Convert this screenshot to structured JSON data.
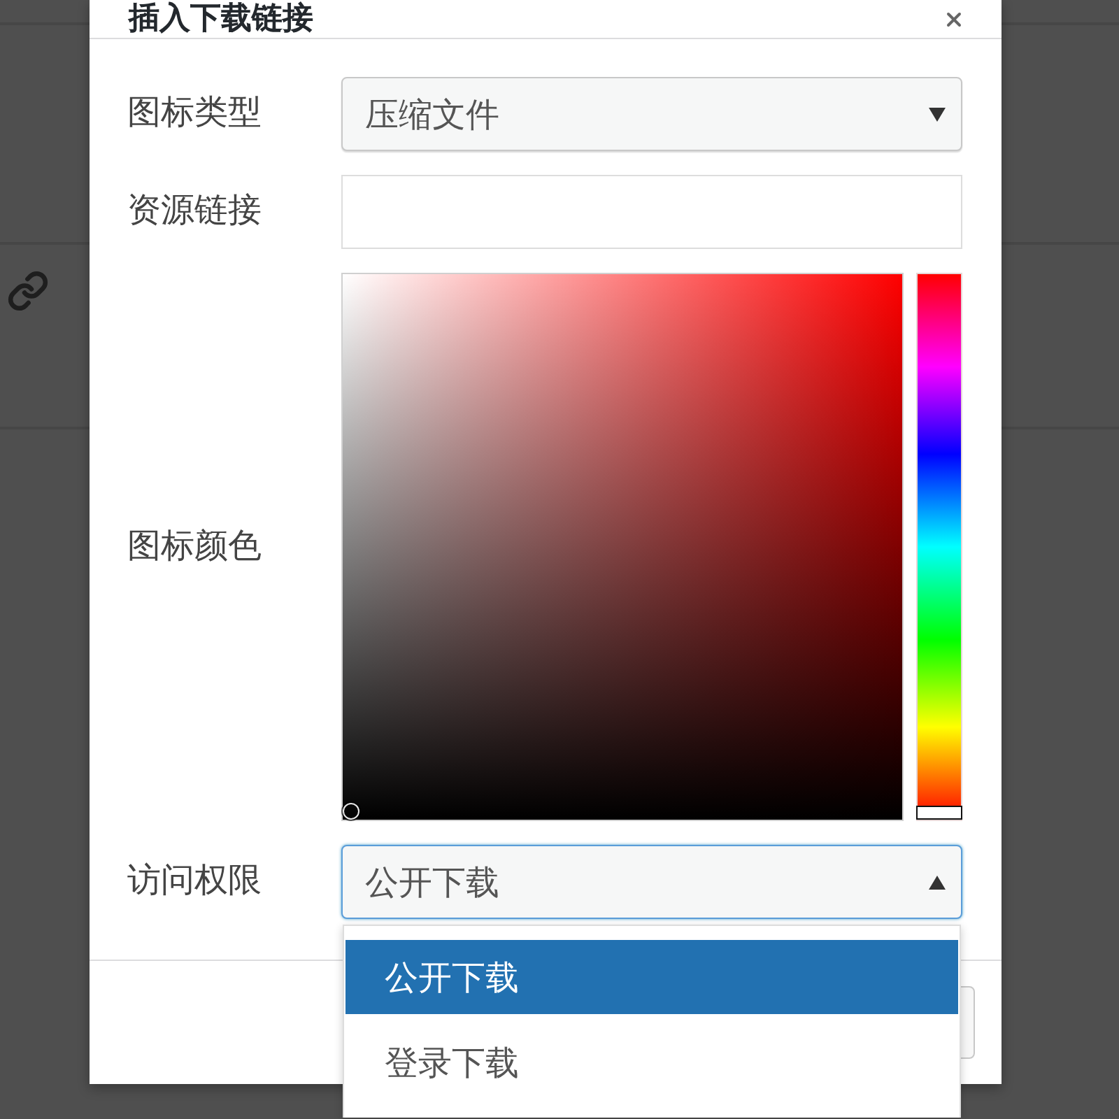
{
  "dialog": {
    "title": "插入下载链接"
  },
  "fields": [
    {
      "kind": "select",
      "label": "图标类型",
      "value": "压缩文件",
      "expanded": false
    },
    {
      "kind": "text",
      "label": "资源链接"
    },
    {
      "kind": "color",
      "label": "图标颜色",
      "hue": {
        "level": 0
      },
      "saturation": {
        "level": 0
      },
      "brightness": {
        "level": 0
      }
    },
    {
      "kind": "select",
      "label": "访问权限",
      "value": "公开下载",
      "expanded": true,
      "options": [
        {
          "label": "公开下载",
          "selected": true
        },
        {
          "label": "登录下载",
          "selected": false
        }
      ]
    }
  ]
}
